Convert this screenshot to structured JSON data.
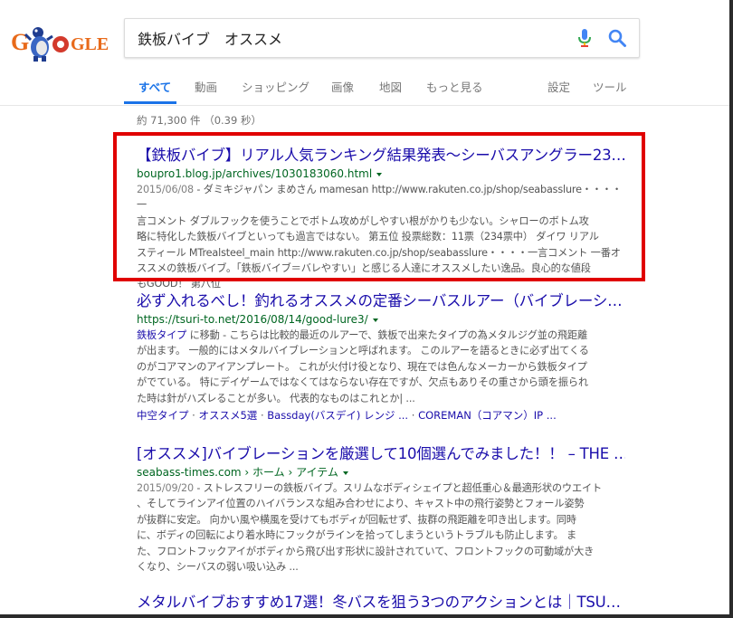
{
  "search": {
    "query": "鉄板バイブ　オススメ"
  },
  "tabs": [
    {
      "label": "すべて"
    },
    {
      "label": "動画"
    },
    {
      "label": "ショッピング"
    },
    {
      "label": "画像"
    },
    {
      "label": "地図"
    },
    {
      "label": "もっと見る"
    },
    {
      "label": "設定"
    },
    {
      "label": "ツール"
    }
  ],
  "stats": "約 71,300 件 （0.39 秒）",
  "colors": {
    "link": "#1a0dab",
    "url": "#006621",
    "active_tab": "#1a73e8",
    "highlight": "#e00000"
  },
  "results": [
    {
      "title": "【鉄板バイブ】リアル人気ランキング結果発表～シーバスアングラー23…",
      "url": "boupro1.blog.jp/archives/1030183060.html",
      "date": "2015/06/08",
      "snippet_lines": [
        " - ダミキジャパン まめさん mamesan http://www.rakuten.co.jp/shop/seabasslure・・・・一",
        "言コメント ダブルフックを使うことでボトム攻めがしやすい根がかりも少ない。シャローのボトム攻",
        "略に特化した鉄板バイブといっても過言ではない。 第五位 投票総数：11票（234票中） ダイワ リアル",
        "スティール MTrealsteel_main http://www.rakuten.co.jp/shop/seabasslure・・・・一言コメント 一番オ",
        "ススメの鉄板バイブ。「鉄板バイブ＝バレやすい」と感じる人達にオススメしたい逸品。良心的な値段",
        "もGOOD！ 第八位"
      ]
    },
    {
      "title": "必ず入れるべし！釣れるオススメの定番シーバスルアー（バイブレーシ…",
      "url": "https://tsuri-to.net/2016/08/14/good-lure3/",
      "jump_text": "鉄板タイプ",
      "jump_suffix": " に移動 - こちらは比較的最近のルアーで、鉄板で出来たタイプの為メタルジグ並の飛距離",
      "snippet_lines": [
        "が出ます。 一般的にはメタルバイブレーションと呼ばれます。 このルアーを語るときに必ず出てくる",
        "のがコアマンのアイアンプレート。 これが火付け役となり、現在では色んなメーカーから鉄板タイプ",
        "がでている。 特にデイゲームではなくてはならない存在ですが、欠点もありその重さから頭を振られ",
        "た時は針がハズレることが多い。 代表的なものはこれとか| ..."
      ],
      "sitelinks": [
        "中空タイプ",
        "オススメ5選",
        "Bassday(バスデイ) レンジ ...",
        "COREMAN（コアマン）IP ..."
      ]
    },
    {
      "title": "[オススメ]バイブレーションを厳選して10個選んでみました！！ – THE …",
      "url": "seabass-times.com › ホーム › アイテム",
      "date": "2015/09/20",
      "snippet_lines": [
        " - ストレスフリーの鉄板バイブ。スリムなボディシェイプと超低重心＆最適形状のウエイト",
        "、そしてラインアイ位置のハイバランスな組み合わせにより、キャスト中の飛行姿勢とフォール姿勢",
        "が抜群に安定。 向かい風や横風を受けてもボディが回転せず、抜群の飛距離を叩き出します。同時",
        "に、ボディの回転により着水時にフックがラインを拾ってしまうというトラブルも防止します。 ま",
        "た、フロントフックアイがボディから飛び出す形状に設計されていて、フロントフックの可動域が大き",
        "くなり、シーバスの弱い吸い込み ..."
      ]
    },
    {
      "title": "メタルバイブおすすめ17選！冬バスを狙う3つのアクションとは｜TSU…"
    }
  ]
}
